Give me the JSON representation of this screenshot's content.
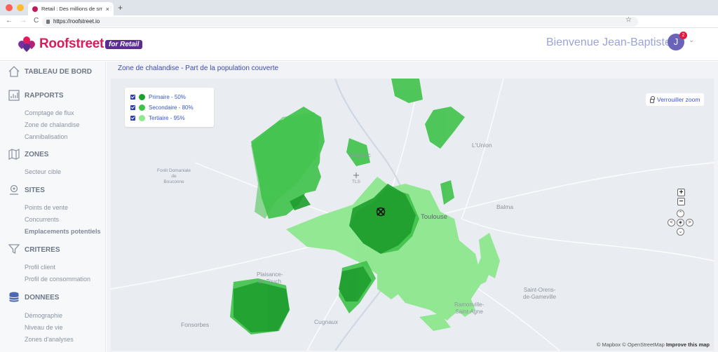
{
  "browser": {
    "tab_title": "Retail : Des millions de smartp",
    "tab_close": "×",
    "new_tab": "+",
    "url": "https://roofstreet.io",
    "back": "←",
    "forward": "→",
    "reload": "C",
    "bookmark": "☆"
  },
  "header": {
    "brand": "Roofstreet",
    "brand_badge": "for Retail",
    "welcome": "Bienvenue Jean-Baptiste",
    "avatar_initial": "J",
    "notification_count": "2",
    "menu_chevron": "⌄"
  },
  "sidebar": {
    "dashboard": "TABLEAU DE BORD",
    "reports": {
      "label": "RAPPORTS",
      "items": [
        "Comptage de flux",
        "Zone de chalandise",
        "Cannibalisation"
      ]
    },
    "zones": {
      "label": "ZONES",
      "items": [
        "Secteur cible"
      ]
    },
    "sites": {
      "label": "SITES",
      "items": [
        "Points de vente",
        "Concurrents",
        "Emplacements potentiels"
      ]
    },
    "criteria": {
      "label": "CRITERES",
      "items": [
        "Profil client",
        "Profil de consommation"
      ]
    },
    "data": {
      "label": "DONNEES",
      "items": [
        "Démographie",
        "Niveau de vie",
        "Zones d'analyses"
      ]
    }
  },
  "main": {
    "title": "Zone de chalandise - Part de la population couverte",
    "legend": [
      {
        "label": "Primaire - 50%",
        "color": "#1e9e2e"
      },
      {
        "label": "Secondaire - 80%",
        "color": "#3fc24a"
      },
      {
        "label": "Tertiaire - 95%",
        "color": "#8ee88e"
      }
    ],
    "lock_zoom": "Verrouiller zoom",
    "zoom_in": "+",
    "zoom_out": "−",
    "pan": {
      "up": "⌃",
      "down": "⌄",
      "left": "<",
      "right": ">",
      "center": "◈"
    },
    "attribution": {
      "mapbox": "© Mapbox",
      "osm": "© OpenStreetMap",
      "improve": "Improve this map"
    },
    "places": {
      "foret": "Forêt Domaniale\nde\nBouconne",
      "blagnac": "Blagnac",
      "tls": "TLS",
      "lunion": "L'Union",
      "balma": "Balma",
      "toulouse": "Toulouse",
      "plaisance": "Plaisance-\ndu-Touch",
      "saint_orens": "Saint-Orens-\nde-Gameville",
      "ramonville": "Ramonville-\nSaint-Agne",
      "fonsorbes": "Fonsorbes",
      "cugnaux": "Cugnaux"
    }
  }
}
